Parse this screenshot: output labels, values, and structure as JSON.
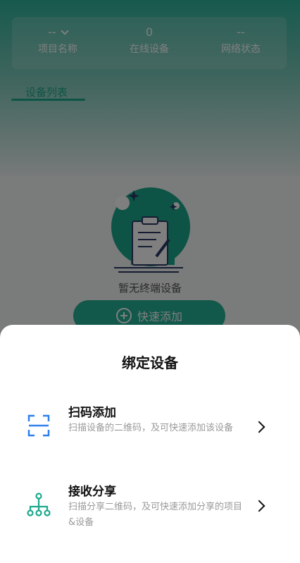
{
  "stats": [
    {
      "value": "--",
      "label": "项目名称",
      "has_dropdown": true
    },
    {
      "value": "0",
      "label": "在线设备"
    },
    {
      "value": "--",
      "label": "网络状态"
    }
  ],
  "tab": {
    "label": "设备列表"
  },
  "empty": {
    "text": "暂无终端设备",
    "icon": "empty-clipboard-illustration"
  },
  "quick_add": {
    "label": "快速添加",
    "icon": "plus-circle-icon"
  },
  "sheet": {
    "title": "绑定设备",
    "options": [
      {
        "title": "扫码添加",
        "desc": "扫描设备的二维码，及可快速添加该设备",
        "icon": "scan-icon",
        "color": "#2f80ed"
      },
      {
        "title": "接收分享",
        "desc": "扫描分享二维码，及可快速添加分享的项目&设备",
        "icon": "share-tree-icon",
        "color": "#1aa88c"
      }
    ]
  },
  "colors": {
    "accent": "#1aa88c",
    "scan_icon": "#2f80ed"
  }
}
